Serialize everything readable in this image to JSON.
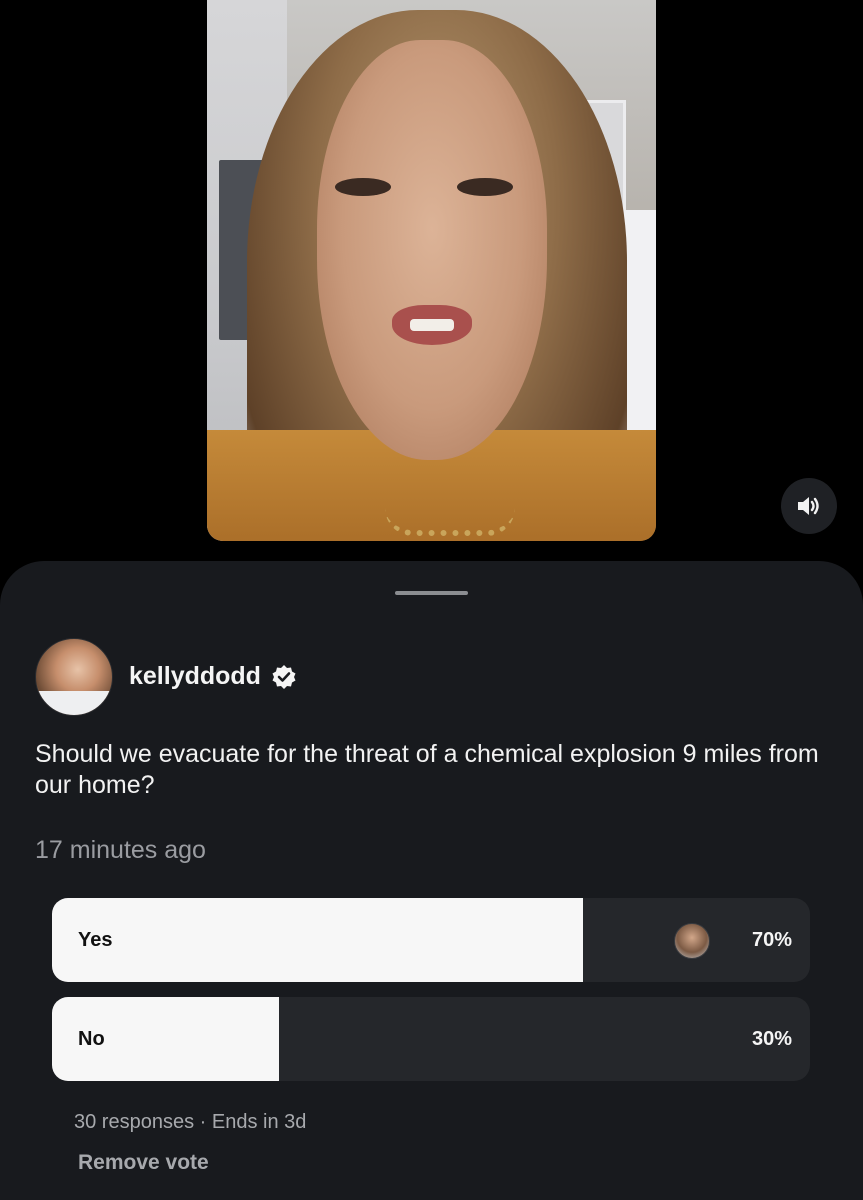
{
  "video": {
    "sound_icon": "speaker-on-icon"
  },
  "post": {
    "username": "kellyddodd",
    "verified_icon": "verified-badge-icon",
    "question": "Should we evacuate for the threat of a chemical explosion 9 miles from our home?",
    "timestamp": "17 minutes ago"
  },
  "poll": {
    "options": [
      {
        "label": "Yes",
        "percent_text": "70%",
        "percent": 70,
        "has_voter_avatar": true
      },
      {
        "label": "No",
        "percent_text": "30%",
        "percent": 30,
        "has_voter_avatar": false
      }
    ],
    "meta": "30 responses · Ends in 3d",
    "remove_vote_label": "Remove vote"
  },
  "colors": {
    "background": "#000000",
    "sheet": "#181a1e",
    "option_track": "#25272b",
    "option_fill": "#f7f7f7",
    "secondary_text": "#9a9ca1"
  }
}
